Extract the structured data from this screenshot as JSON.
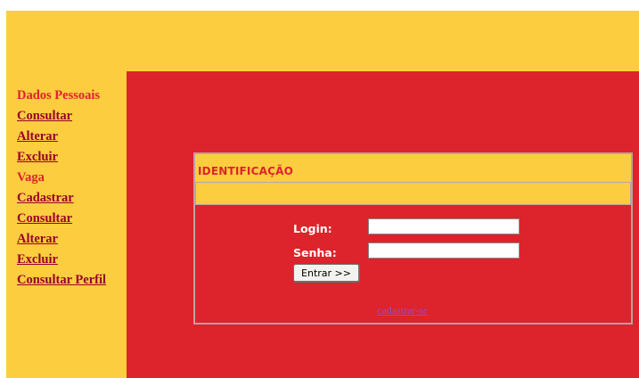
{
  "colors": {
    "yellow": "#fccd3f",
    "red": "#dd232b",
    "link": "#98002b",
    "frame_border": "#b9a4a4"
  },
  "sidebar": {
    "sections": [
      {
        "heading": "Dados Pessoais",
        "links": [
          "Consultar",
          "Alterar",
          "Excluir"
        ]
      },
      {
        "heading": "Vaga",
        "links": [
          "Cadastrar",
          "Consultar",
          "Alterar",
          "Excluir",
          "Consultar Perfil"
        ]
      }
    ]
  },
  "login": {
    "title": "IDENTIFICAÇÃO",
    "login_label": "Login:",
    "login_value": "",
    "password_label": "Senha:",
    "password_value": "",
    "submit_label": "Entrar >>",
    "register_link": "cadastrar-se"
  }
}
